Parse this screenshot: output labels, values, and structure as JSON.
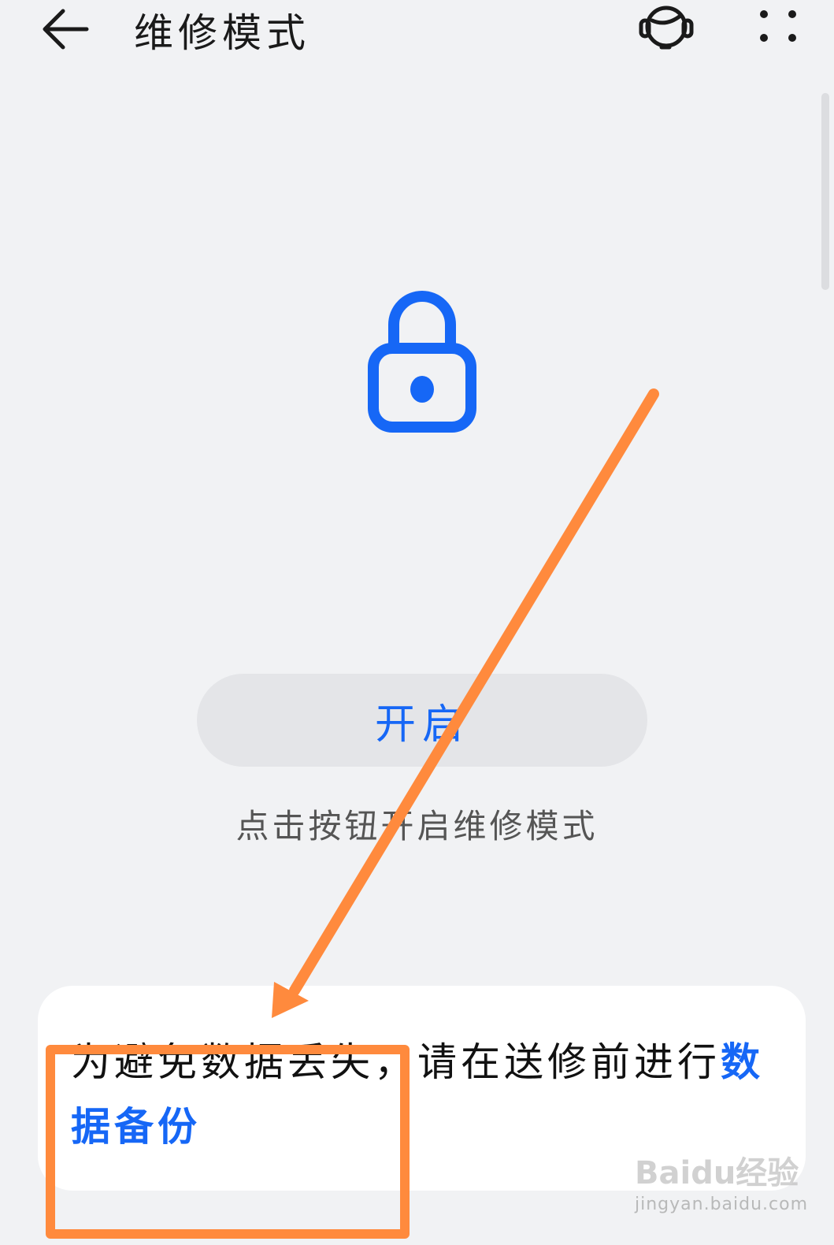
{
  "header": {
    "title": "维修模式",
    "back_icon": "arrow-left-icon",
    "support_icon": "headset-icon",
    "more_icon": "more-dots-icon"
  },
  "main": {
    "lock_icon": "lock-icon",
    "enable_button_label": "开启",
    "hint": "点击按钮开启维修模式"
  },
  "notice": {
    "text": "为避免数据丢失，请在送修前进行",
    "link_label": "数据备份"
  },
  "watermark": {
    "logo": "Baidu经验",
    "url": "jingyan.baidu.com"
  },
  "colors": {
    "accent": "#1667f6",
    "background": "#f1f2f4",
    "annotation": "#ff8a3d"
  }
}
